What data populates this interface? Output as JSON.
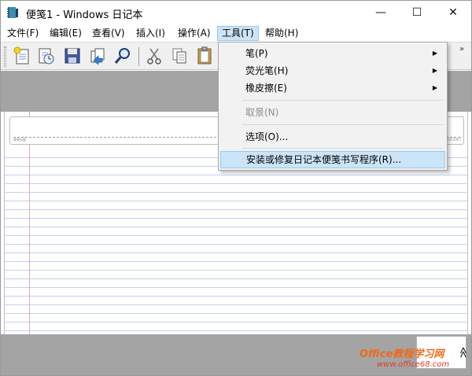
{
  "window": {
    "title": "便笺1 - Windows 日记本",
    "controls": {
      "minimize": "—",
      "maximize": "☐",
      "close": "✕"
    }
  },
  "menubar": [
    {
      "label": "文件(F)"
    },
    {
      "label": "编辑(E)"
    },
    {
      "label": "查看(V)"
    },
    {
      "label": "插入(I)"
    },
    {
      "label": "操作(A)"
    },
    {
      "label": "工具(T)",
      "active": true
    },
    {
      "label": "帮助(H)"
    }
  ],
  "toolbar": {
    "buttons": [
      {
        "icon": "new-note-icon"
      },
      {
        "icon": "open-icon"
      },
      {
        "icon": "save-icon"
      },
      {
        "icon": "export-icon"
      },
      {
        "icon": "find-icon"
      },
      {
        "icon": "cut-icon"
      },
      {
        "icon": "copy-icon"
      },
      {
        "icon": "paste-icon"
      }
    ],
    "overflow": "»"
  },
  "tools_menu": {
    "items": [
      {
        "label": "笔(P)",
        "submenu": true,
        "enabled": true
      },
      {
        "label": "荧光笔(H)",
        "submenu": true,
        "enabled": true
      },
      {
        "label": "橡皮擦(E)",
        "submenu": true,
        "enabled": true
      },
      {
        "label": "取景(N)",
        "submenu": false,
        "enabled": false
      },
      {
        "label": "选项(O)...",
        "submenu": false,
        "enabled": true
      },
      {
        "label": "安装或修复日记本便笺书写程序(R)...",
        "submenu": false,
        "enabled": true,
        "highlighted": true
      }
    ],
    "arrow": "▶"
  },
  "note": {
    "header_left": "便笺标题",
    "header_right": "2015/9/7"
  },
  "scroll": {
    "icon": "scroll-up-icon",
    "glyph": "≪"
  },
  "watermark": {
    "line1": "Office教程学习网",
    "line2": "www.office68.com"
  },
  "colors": {
    "menu_highlight": "#cce4f7",
    "rule_lines": "#c5cff2",
    "margin_line": "#e3a7b9",
    "gray_background": "#a4a4a4"
  }
}
